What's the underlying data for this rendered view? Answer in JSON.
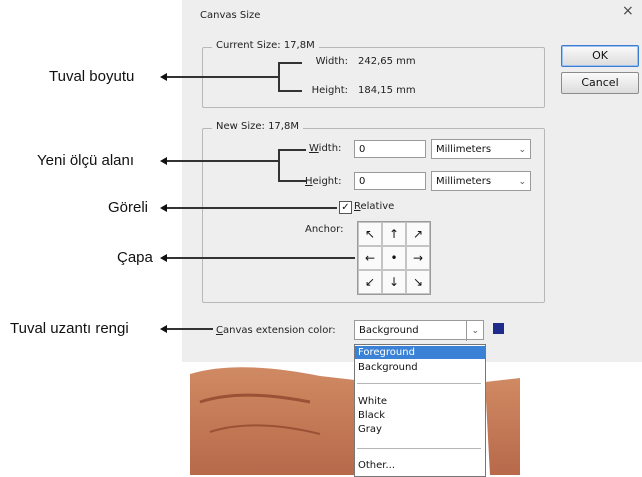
{
  "dialog": {
    "title": "Canvas Size",
    "close_glyph": "×",
    "ok_label": "OK",
    "cancel_label": "Cancel"
  },
  "current_size": {
    "legend": "Current Size: 17,8M",
    "width_label": "Width:",
    "width_value": "242,65 mm",
    "height_label": "Height:",
    "height_value": "184,15 mm"
  },
  "new_size": {
    "legend": "New Size: 17,8M",
    "width_label_first": "W",
    "width_label_rest": "idth:",
    "width_value": "0",
    "width_unit": "Millimeters",
    "height_label_first": "H",
    "height_label_rest": "eight:",
    "height_value": "0",
    "height_unit": "Millimeters",
    "relative_label_first": "R",
    "relative_label_rest": "elative",
    "relative_checked": true,
    "anchor_label": "Anchor:",
    "anchor_cells": [
      "↖",
      "↑",
      "↗",
      "←",
      "•",
      "→",
      "↙",
      "↓",
      "↘"
    ]
  },
  "extension": {
    "label_first": "C",
    "label_rest": "anvas extension color:",
    "selected": "Background",
    "swatch_color": "#1f2a8a",
    "options_group1": [
      "Foreground",
      "Background"
    ],
    "options_group2": [
      "White",
      "Black",
      "Gray"
    ],
    "options_group3": [
      "Other..."
    ]
  },
  "annotations": {
    "canvas_size": "Tuval boyutu",
    "new_size_area": "Yeni ölçü alanı",
    "relative": "Göreli",
    "anchor": "Çapa",
    "extension_color": "Tuval uzantı rengi"
  },
  "colors": {
    "dialog_bg": "#eeeeee",
    "highlight": "#3b82d6"
  },
  "icons": {
    "dropdown": "chevron-down-icon",
    "close": "close-icon",
    "annotation_arrow": "arrow-left-icon"
  }
}
